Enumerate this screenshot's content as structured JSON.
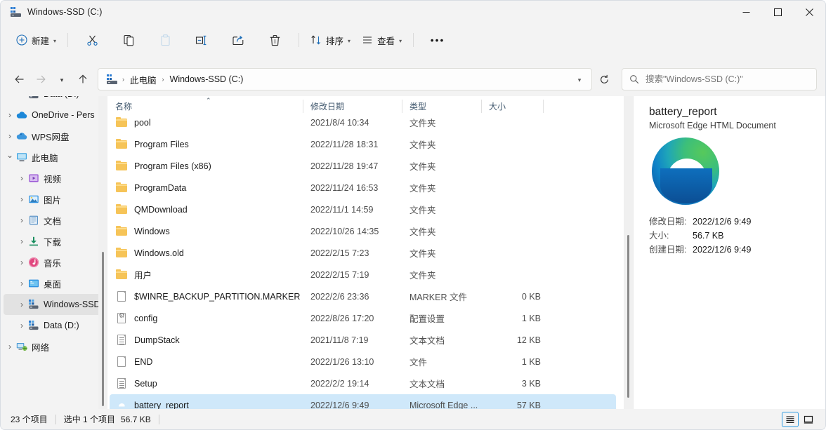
{
  "window": {
    "title": "Windows-SSD (C:)",
    "icon": "drive-icon",
    "minimize_label": "—",
    "maximize_label": "□",
    "close_label": "✕"
  },
  "toolbar": {
    "new_label": "新建",
    "cut_label": "剪切",
    "copy_label": "复制",
    "paste_label": "粘贴",
    "rename_label": "重命名",
    "share_label": "共享",
    "delete_label": "删除",
    "sort_label": "排序",
    "view_label": "查看",
    "more_label": "•••"
  },
  "addressbar": {
    "back_label": "←",
    "forward_label": "→",
    "recent_label": "⌄",
    "up_label": "↑",
    "refresh_label": "⟳",
    "dropdown_label": "⌄",
    "breadcrumbs": [
      {
        "label": "此电脑"
      },
      {
        "label": "Windows-SSD (C:)"
      }
    ],
    "separator": "›"
  },
  "search": {
    "placeholder": "搜索\"Windows-SSD (C:)\"",
    "value": "",
    "icon": "search-icon"
  },
  "sidebar": {
    "items": [
      {
        "label": "Data (D:)",
        "icon": "drive-icon",
        "indent": 1,
        "expander": "",
        "selected": false
      },
      {
        "label": "OneDrive - Pers",
        "icon": "cloud-icon",
        "indent": 0,
        "expander": "›",
        "selected": false
      },
      {
        "label": "WPS网盘",
        "icon": "wps-cloud-icon",
        "indent": 0,
        "expander": "›",
        "selected": false
      },
      {
        "label": "此电脑",
        "icon": "pc-icon",
        "indent": 0,
        "expander": "⌄",
        "selected": false
      },
      {
        "label": "视频",
        "icon": "video-icon",
        "indent": 1,
        "expander": "›",
        "selected": false
      },
      {
        "label": "图片",
        "icon": "pictures-icon",
        "indent": 1,
        "expander": "›",
        "selected": false
      },
      {
        "label": "文档",
        "icon": "documents-icon",
        "indent": 1,
        "expander": "›",
        "selected": false
      },
      {
        "label": "下载",
        "icon": "downloads-icon",
        "indent": 1,
        "expander": "›",
        "selected": false
      },
      {
        "label": "音乐",
        "icon": "music-icon",
        "indent": 1,
        "expander": "›",
        "selected": false
      },
      {
        "label": "桌面",
        "icon": "desktop-icon",
        "indent": 1,
        "expander": "›",
        "selected": false
      },
      {
        "label": "Windows-SSD",
        "icon": "drive-icon",
        "indent": 1,
        "expander": "›",
        "selected": true
      },
      {
        "label": "Data (D:)",
        "icon": "drive-icon",
        "indent": 1,
        "expander": "›",
        "selected": false
      },
      {
        "label": "网络",
        "icon": "network-icon",
        "indent": 0,
        "expander": "›",
        "selected": false
      }
    ]
  },
  "filelist": {
    "columns": [
      {
        "key": "name",
        "label": "名称",
        "sorted": true,
        "sort_direction": "⌃"
      },
      {
        "key": "date",
        "label": "修改日期"
      },
      {
        "key": "type",
        "label": "类型"
      },
      {
        "key": "size",
        "label": "大小"
      }
    ],
    "rows": [
      {
        "name": "pool",
        "date": "2021/8/4 10:34",
        "type": "文件夹",
        "size": "",
        "icon": "folder-icon",
        "selected": false
      },
      {
        "name": "Program Files",
        "date": "2022/11/28 18:31",
        "type": "文件夹",
        "size": "",
        "icon": "folder-icon",
        "selected": false
      },
      {
        "name": "Program Files (x86)",
        "date": "2022/11/28 19:47",
        "type": "文件夹",
        "size": "",
        "icon": "folder-icon",
        "selected": false
      },
      {
        "name": "ProgramData",
        "date": "2022/11/24 16:53",
        "type": "文件夹",
        "size": "",
        "icon": "folder-icon",
        "selected": false
      },
      {
        "name": "QMDownload",
        "date": "2022/11/1 14:59",
        "type": "文件夹",
        "size": "",
        "icon": "folder-icon",
        "selected": false
      },
      {
        "name": "Windows",
        "date": "2022/10/26 14:35",
        "type": "文件夹",
        "size": "",
        "icon": "folder-icon",
        "selected": false
      },
      {
        "name": "Windows.old",
        "date": "2022/2/15 7:23",
        "type": "文件夹",
        "size": "",
        "icon": "folder-icon",
        "selected": false
      },
      {
        "name": "用户",
        "date": "2022/2/15 7:19",
        "type": "文件夹",
        "size": "",
        "icon": "folder-icon",
        "selected": false
      },
      {
        "name": "$WINRE_BACKUP_PARTITION.MARKER",
        "date": "2022/2/6 23:36",
        "type": "MARKER 文件",
        "size": "0 KB",
        "icon": "blank-doc-icon",
        "selected": false
      },
      {
        "name": "config",
        "date": "2022/8/26 17:20",
        "type": "配置设置",
        "size": "1 KB",
        "icon": "config-icon",
        "selected": false
      },
      {
        "name": "DumpStack",
        "date": "2021/11/8 7:19",
        "type": "文本文档",
        "size": "12 KB",
        "icon": "text-doc-icon",
        "selected": false
      },
      {
        "name": "END",
        "date": "2022/1/26 13:10",
        "type": "文件",
        "size": "1 KB",
        "icon": "blank-doc-icon",
        "selected": false
      },
      {
        "name": "Setup",
        "date": "2022/2/2 19:14",
        "type": "文本文档",
        "size": "3 KB",
        "icon": "text-doc-icon",
        "selected": false
      },
      {
        "name": "battery_report",
        "date": "2022/12/6 9:49",
        "type": "Microsoft Edge ...",
        "size": "57 KB",
        "icon": "edge-icon",
        "selected": true
      }
    ]
  },
  "details": {
    "title": "battery_report",
    "subtitle": "Microsoft Edge HTML Document",
    "thumbnail_icon": "edge-icon",
    "meta": [
      {
        "key": "修改日期:",
        "value": "2022/12/6 9:49"
      },
      {
        "key": "大小:",
        "value": "56.7 KB"
      },
      {
        "key": "创建日期:",
        "value": "2022/12/6 9:49"
      }
    ]
  },
  "statusbar": {
    "item_count": "23 个项目",
    "selection": "选中 1 个项目",
    "selection_size": "56.7 KB",
    "details_view_label": "详细信息",
    "large_icons_view_label": "大图标"
  },
  "colors": {
    "accent": "#2b9ae0",
    "selection": "#cfe8fa",
    "chrome": "#f3f3f3",
    "header_text": "#40576d",
    "folder": "#f6c458"
  }
}
